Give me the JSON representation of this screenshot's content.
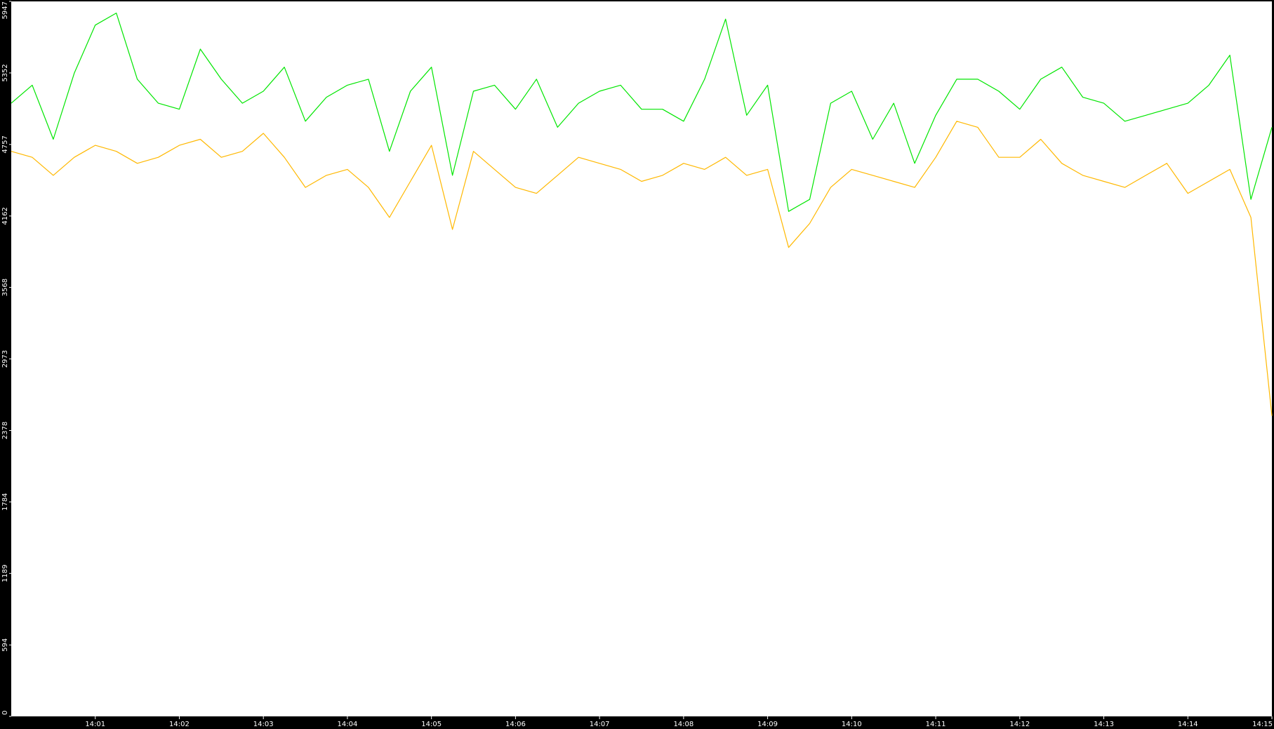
{
  "colors": {
    "background": "#000000",
    "plot_background": "#ffffff",
    "axis_text": "#ffffff",
    "series_green": "#00e600",
    "series_orange": "#ffb800"
  },
  "chart_data": {
    "type": "line",
    "title": "",
    "xlabel": "",
    "ylabel": "",
    "grid": false,
    "legend": "none",
    "ylim": [
      0,
      5947
    ],
    "y_ticks": [
      {
        "value": 0,
        "label": "0"
      },
      {
        "value": 594,
        "label": "594"
      },
      {
        "value": 1189,
        "label": "1189"
      },
      {
        "value": 1784,
        "label": "1784"
      },
      {
        "value": 2378,
        "label": "2378"
      },
      {
        "value": 2973,
        "label": "2973"
      },
      {
        "value": 3568,
        "label": "3568"
      },
      {
        "value": 4162,
        "label": "4162"
      },
      {
        "value": 4757,
        "label": "4757"
      },
      {
        "value": 5352,
        "label": "5352"
      },
      {
        "value": 5947,
        "label": "5947"
      }
    ],
    "xlim": [
      "14:00",
      "14:15"
    ],
    "x_ticks": [
      {
        "value": "14:01",
        "label": "14:01"
      },
      {
        "value": "14:02",
        "label": "14:02"
      },
      {
        "value": "14:03",
        "label": "14:03"
      },
      {
        "value": "14:04",
        "label": "14:04"
      },
      {
        "value": "14:05",
        "label": "14:05"
      },
      {
        "value": "14:06",
        "label": "14:06"
      },
      {
        "value": "14:07",
        "label": "14:07"
      },
      {
        "value": "14:08",
        "label": "14:08"
      },
      {
        "value": "14:09",
        "label": "14:09"
      },
      {
        "value": "14:10",
        "label": "14:10"
      },
      {
        "value": "14:11",
        "label": "14:11"
      },
      {
        "value": "14:12",
        "label": "14:12"
      },
      {
        "value": "14:13",
        "label": "14:13"
      },
      {
        "value": "14:14",
        "label": "14:14"
      },
      {
        "value": "14:15",
        "label": "14:15"
      }
    ],
    "x": [
      "14:00:00",
      "14:00:15",
      "14:00:30",
      "14:00:45",
      "14:01:00",
      "14:01:15",
      "14:01:30",
      "14:01:45",
      "14:02:00",
      "14:02:15",
      "14:02:30",
      "14:02:45",
      "14:03:00",
      "14:03:15",
      "14:03:30",
      "14:03:45",
      "14:04:00",
      "14:04:15",
      "14:04:30",
      "14:04:45",
      "14:05:00",
      "14:05:15",
      "14:05:30",
      "14:05:45",
      "14:06:00",
      "14:06:15",
      "14:06:30",
      "14:06:45",
      "14:07:00",
      "14:07:15",
      "14:07:30",
      "14:07:45",
      "14:08:00",
      "14:08:15",
      "14:08:30",
      "14:08:45",
      "14:09:00",
      "14:09:15",
      "14:09:30",
      "14:09:45",
      "14:10:00",
      "14:10:15",
      "14:10:30",
      "14:10:45",
      "14:11:00",
      "14:11:15",
      "14:11:30",
      "14:11:45",
      "14:12:00",
      "14:12:15",
      "14:12:30",
      "14:12:45",
      "14:13:00",
      "14:13:15",
      "14:13:30",
      "14:13:45",
      "14:14:00",
      "14:14:15",
      "14:14:30",
      "14:14:45",
      "14:15:00"
    ],
    "series": [
      {
        "color": "#00e600",
        "values": [
          5100,
          5250,
          4800,
          5350,
          5750,
          5850,
          5300,
          5100,
          5050,
          5550,
          5300,
          5100,
          5200,
          5400,
          4950,
          5150,
          5250,
          5300,
          4700,
          5200,
          5400,
          4500,
          5200,
          5250,
          5050,
          5300,
          4900,
          5100,
          5200,
          5250,
          5050,
          5050,
          4950,
          5300,
          5800,
          5000,
          5250,
          4200,
          4300,
          5100,
          5200,
          4800,
          5100,
          4600,
          5000,
          5300,
          5300,
          5200,
          5050,
          5300,
          5400,
          5150,
          5100,
          4950,
          5000,
          5050,
          5100,
          5250,
          5500,
          4300,
          4900
        ]
      },
      {
        "color": "#ffb800",
        "values": [
          4700,
          4650,
          4500,
          4650,
          4750,
          4700,
          4600,
          4650,
          4750,
          4800,
          4650,
          4700,
          4850,
          4650,
          4400,
          4500,
          4550,
          4400,
          4150,
          4450,
          4750,
          4050,
          4700,
          4550,
          4400,
          4350,
          4500,
          4650,
          4600,
          4550,
          4450,
          4500,
          4600,
          4550,
          4650,
          4500,
          4550,
          3900,
          4100,
          4400,
          4550,
          4500,
          4450,
          4400,
          4650,
          4950,
          4900,
          4650,
          4650,
          4800,
          4600,
          4500,
          4450,
          4400,
          4500,
          4600,
          4350,
          4450,
          4550,
          4150,
          2500
        ]
      }
    ]
  }
}
